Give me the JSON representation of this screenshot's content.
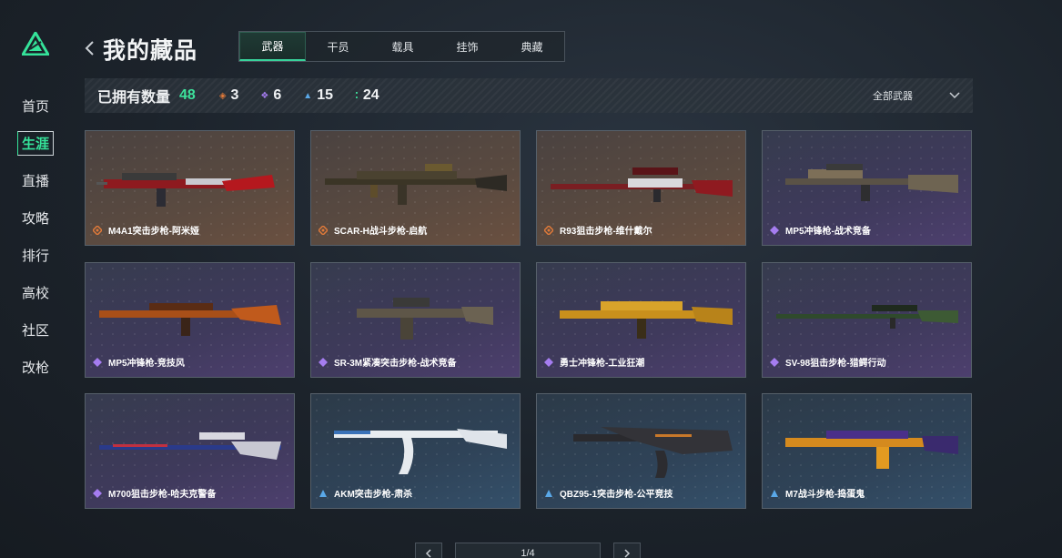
{
  "sidebar": {
    "logo": "triangle-logo",
    "items": [
      {
        "label": "首页"
      },
      {
        "label": "生涯",
        "active": true
      },
      {
        "label": "直播"
      },
      {
        "label": "攻略"
      },
      {
        "label": "排行"
      },
      {
        "label": "高校"
      },
      {
        "label": "社区"
      },
      {
        "label": "改枪"
      }
    ]
  },
  "header": {
    "title": "我的藏品",
    "tabs": [
      {
        "label": "武器",
        "active": true
      },
      {
        "label": "干员"
      },
      {
        "label": "载具"
      },
      {
        "label": "挂饰"
      },
      {
        "label": "典藏"
      }
    ]
  },
  "stats": {
    "label": "已拥有数量",
    "total": "48",
    "orange": "3",
    "purple": "6",
    "blue": "15",
    "green": "24",
    "filter": "全部武器"
  },
  "colors": {
    "accent": "#35e39a",
    "orange_rarity": "#e07a3a",
    "purple_rarity": "#a57df0",
    "blue_rarity": "#5aa8e8",
    "green_rarity": "#3de39c"
  },
  "items": [
    {
      "name": "M4A1突击步枪-阿米娅",
      "rarity": "orange"
    },
    {
      "name": "SCAR-H战斗步枪-启航",
      "rarity": "orange"
    },
    {
      "name": "R93狙击步枪-维什戴尔",
      "rarity": "orange"
    },
    {
      "name": "MP5冲锋枪-战术竞备",
      "rarity": "purple"
    },
    {
      "name": "MP5冲锋枪-竞技风",
      "rarity": "purple"
    },
    {
      "name": "SR-3M紧凑突击步枪-战术竞备",
      "rarity": "purple"
    },
    {
      "name": "勇士冲锋枪-工业狂潮",
      "rarity": "purple"
    },
    {
      "name": "SV-98狙击步枪-猎鳄行动",
      "rarity": "purple"
    },
    {
      "name": "M700狙击步枪-哈夫克警备",
      "rarity": "purple"
    },
    {
      "name": "AKM突击步枪-肃杀",
      "rarity": "blue"
    },
    {
      "name": "QBZ95-1突击步枪-公平竞技",
      "rarity": "blue"
    },
    {
      "name": "M7战斗步枪-捣蛋鬼",
      "rarity": "blue"
    }
  ],
  "pagination": {
    "page": "1/4"
  }
}
